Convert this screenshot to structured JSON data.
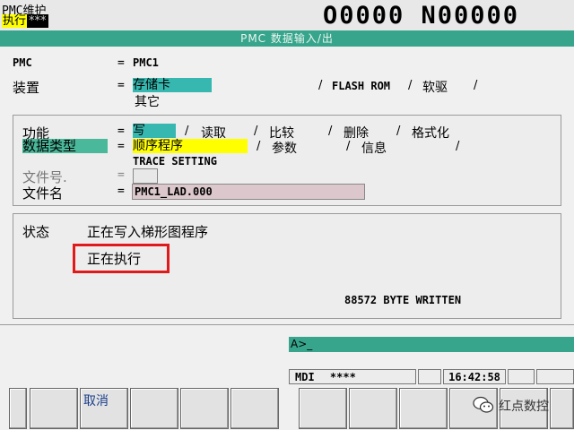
{
  "header": {
    "mode_line1": "PMC维护",
    "mode_run": "执行",
    "mode_stars": "***",
    "program": "O0000 N00000"
  },
  "title_bar": "PMC 数据输入/出",
  "params": {
    "pmc_label": "PMC",
    "pmc_eq": "=",
    "pmc_value": "PMC1",
    "device_label": "装置",
    "device_eq": "=",
    "device_options": [
      "存储卡",
      "FLASH ROM",
      "软驱",
      "其它"
    ],
    "device_selected": "存储卡",
    "slash": "/"
  },
  "ops": {
    "function_label": "功能",
    "function_eq": "=",
    "function_options": [
      "写",
      "读取",
      "比较",
      "删除",
      "格式化"
    ],
    "function_selected": "写",
    "datatype_label": "数据类型",
    "datatype_eq": "=",
    "datatype_options": [
      "顺序程序",
      "参数",
      "信息",
      "TRACE SETTING"
    ],
    "datatype_selected": "顺序程序",
    "fileno_label": "文件号.",
    "fileno_eq": "=",
    "fileno_value": "",
    "filename_label": "文件名",
    "filename_eq": "=",
    "filename_value": "PMC1_LAD.000"
  },
  "status": {
    "label": "状态",
    "message": "正在写入梯形图程序",
    "executing": "正在执行",
    "bytes": "88572 BYTE WRITTEN"
  },
  "input_line": "A>_",
  "statusbar": {
    "mode": "MDI",
    "stars": "****",
    "time": "16:42:58"
  },
  "softkeys": {
    "cancel": "取消"
  },
  "watermark": "红点数控",
  "colors": {
    "accent_teal": "#37a58c",
    "highlight_cyan": "#36b8b0",
    "highlight_yellow": "#ffff00",
    "red_box": "#e01a1a"
  }
}
